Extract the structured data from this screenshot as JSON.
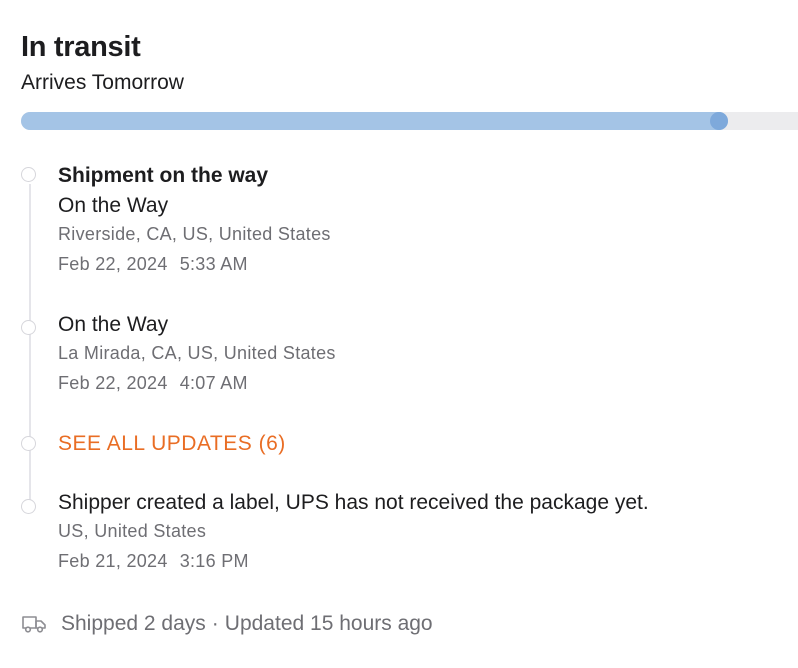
{
  "header": {
    "status_title": "In transit",
    "arrival_text": "Arrives Tomorrow"
  },
  "progress": {
    "fraction": 0.91,
    "fill_color": "#a4c4e6",
    "knob_color": "#7ea9db",
    "track_color": "#ececee"
  },
  "events": [
    {
      "heading": "Shipment on the way",
      "status": "On the Way",
      "location": "Riverside, CA, US, United States",
      "date": "Feb 22, 2024",
      "time": "5:33 AM"
    },
    {
      "status": "On the Way",
      "location": "La Mirada, CA, US, United States",
      "date": "Feb 22, 2024",
      "time": "4:07 AM"
    },
    {
      "status": "Shipper created a label, UPS has not received the package yet.",
      "location": "US, United States",
      "date": "Feb 21, 2024",
      "time": "3:16 PM"
    }
  ],
  "see_all": {
    "label": "SEE ALL UPDATES (6)",
    "color": "#e96d24"
  },
  "footer": {
    "icon": "truck-icon",
    "shipped_text": "Shipped 2 days",
    "separator": "·",
    "updated_text": "Updated 15 hours ago"
  }
}
